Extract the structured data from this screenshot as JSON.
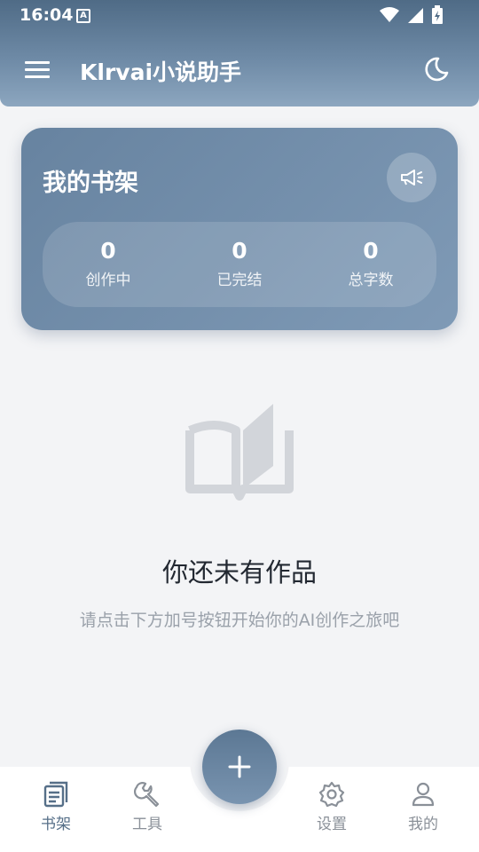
{
  "status_bar": {
    "time": "16:04",
    "notification_icon_label": "A",
    "icons": [
      "wifi-icon",
      "cellular-signal-icon",
      "battery-charging-icon"
    ]
  },
  "header": {
    "title": "Klrvai小说助手",
    "left_icon": "menu-icon",
    "right_icon": "moon-icon"
  },
  "bookshelf_card": {
    "title": "我的书架",
    "action_icon": "megaphone-icon",
    "stats": [
      {
        "value": "0",
        "label": "创作中"
      },
      {
        "value": "0",
        "label": "已完结"
      },
      {
        "value": "0",
        "label": "总字数"
      }
    ]
  },
  "empty_state": {
    "icon": "open-book-icon",
    "title": "你还未有作品",
    "subtitle": "请点击下方加号按钮开始你的AI创作之旅吧"
  },
  "fab": {
    "label": "+",
    "icon": "plus-icon"
  },
  "bottom_nav": {
    "items": [
      {
        "label": "书架",
        "icon": "bookshelf-icon",
        "active": true
      },
      {
        "label": "工具",
        "icon": "wrench-icon",
        "active": false
      },
      {
        "label": "设置",
        "icon": "gear-icon",
        "active": false
      },
      {
        "label": "我的",
        "icon": "person-icon",
        "active": false
      }
    ]
  },
  "colors": {
    "header_start": "#4f6b86",
    "header_end": "#8ca6bf",
    "card_start": "#6783a0",
    "card_end": "#7f9ab6",
    "background": "#f3f4f6",
    "active_nav": "#566f88",
    "inactive_nav": "#8a9098",
    "subtitle_text": "#9aa1aa"
  }
}
